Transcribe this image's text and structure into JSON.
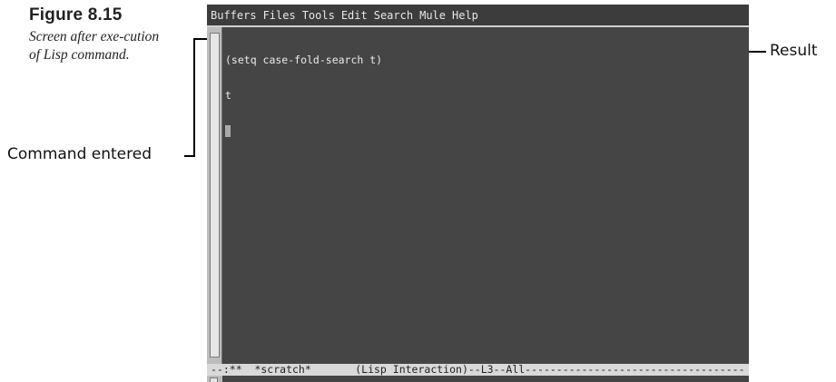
{
  "caption": {
    "figure_label": "Figure 8.15",
    "description": "Screen after exe-cution of Lisp command."
  },
  "callouts": {
    "left": "Command entered",
    "right": "Result"
  },
  "emacs": {
    "menu": [
      "Buffers",
      "Files",
      "Tools",
      "Edit",
      "Search",
      "Mule",
      "Help"
    ],
    "buffer_lines": [
      "(setq case-fold-search t)",
      "t"
    ],
    "modeline": "--:**  *scratch*       (Lisp Interaction)--L3--All-----------------------------------"
  }
}
